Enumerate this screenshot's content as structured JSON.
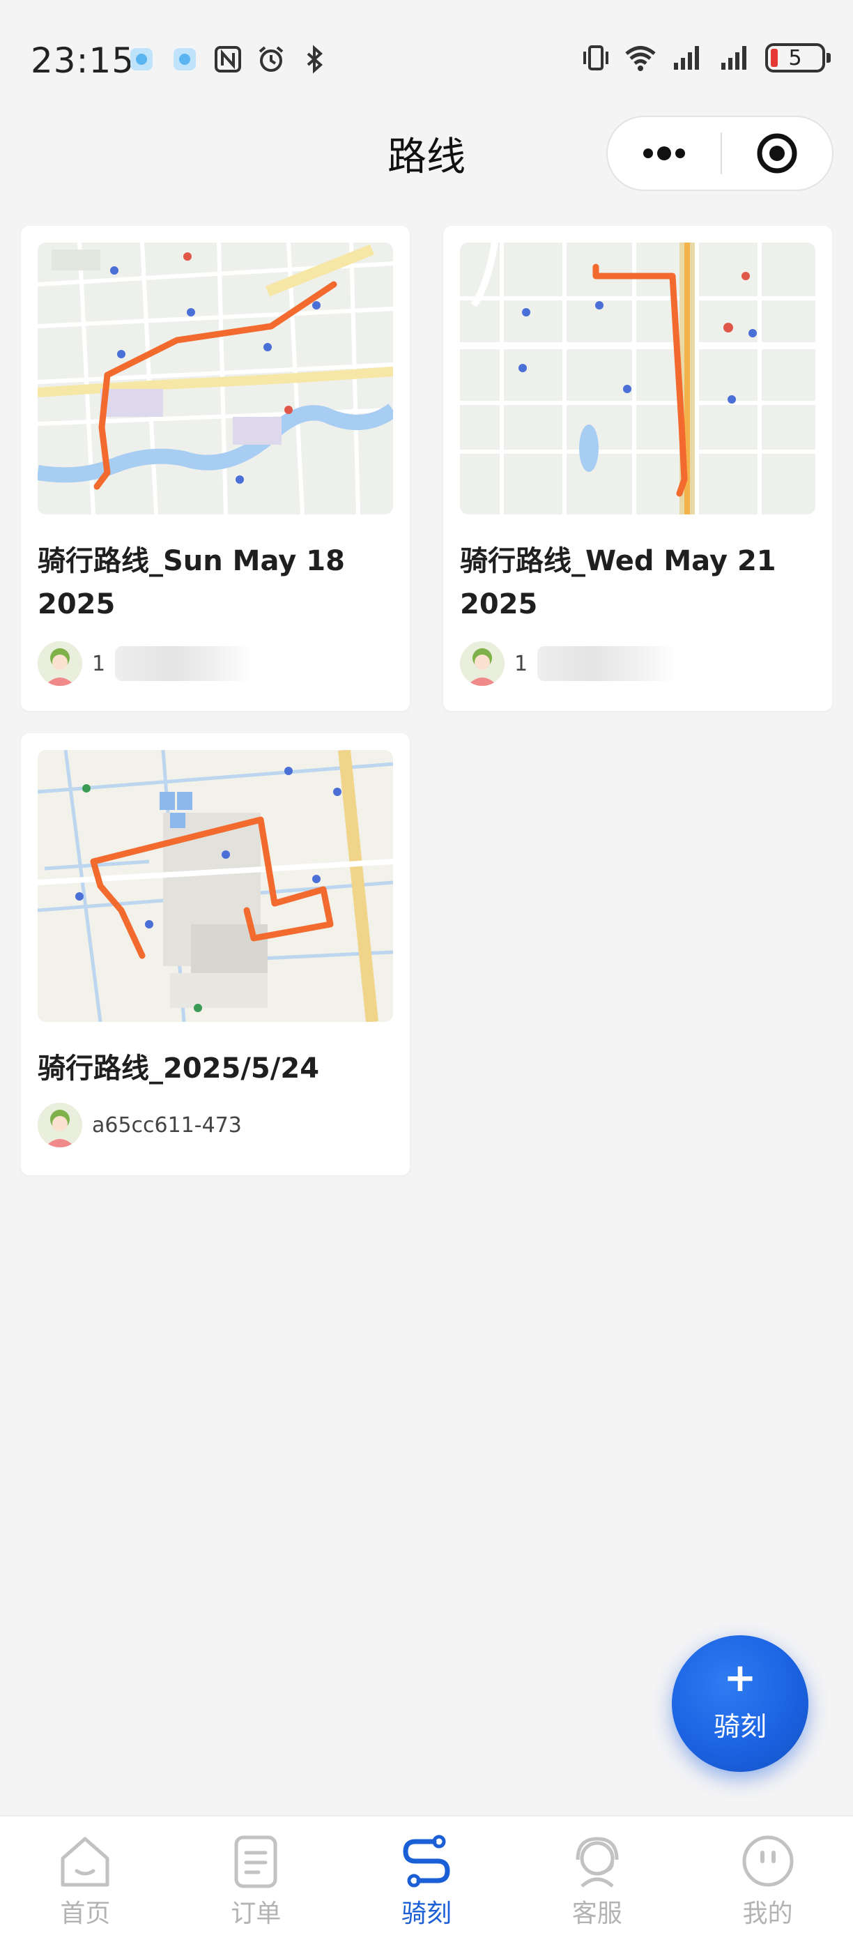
{
  "status_bar": {
    "time": "23:15",
    "battery_level": "5",
    "left_icons": [
      "app-notification-icon",
      "app-notification-icon",
      "nfc-icon",
      "alarm-icon",
      "bluetooth-icon"
    ],
    "right_icons": [
      "vibrate-icon",
      "wifi-icon",
      "signal-icon",
      "signal-icon"
    ]
  },
  "nav": {
    "title": "路线",
    "more_icon": "more-dots-icon",
    "close_icon": "target-circle-icon"
  },
  "routes": [
    {
      "title": "骑行路线_Sun May 18 2025",
      "user_prefix": "1",
      "user_name_blurred": true,
      "route_color": "#f26a2e"
    },
    {
      "title": "骑行路线_Wed May 21 2025",
      "user_prefix": "1",
      "user_name_blurred": true,
      "route_color": "#f26a2e"
    },
    {
      "title": "骑行路线_2025/5/24",
      "user_name": "a65cc611-473",
      "user_name_blurred": false,
      "route_color": "#f26a2e"
    }
  ],
  "fab": {
    "plus": "+",
    "label": "骑刻"
  },
  "tabs": [
    {
      "label": "首页",
      "icon": "home-icon",
      "active": false
    },
    {
      "label": "订单",
      "icon": "order-list-icon",
      "active": false
    },
    {
      "label": "骑刻",
      "icon": "route-icon",
      "active": true
    },
    {
      "label": "客服",
      "icon": "customer-service-icon",
      "active": false
    },
    {
      "label": "我的",
      "icon": "profile-icon",
      "active": false
    }
  ],
  "colors": {
    "accent": "#1b5fd6",
    "route": "#f26a2e",
    "background": "#f4f4f5",
    "tab_inactive": "#b3b3b3"
  }
}
